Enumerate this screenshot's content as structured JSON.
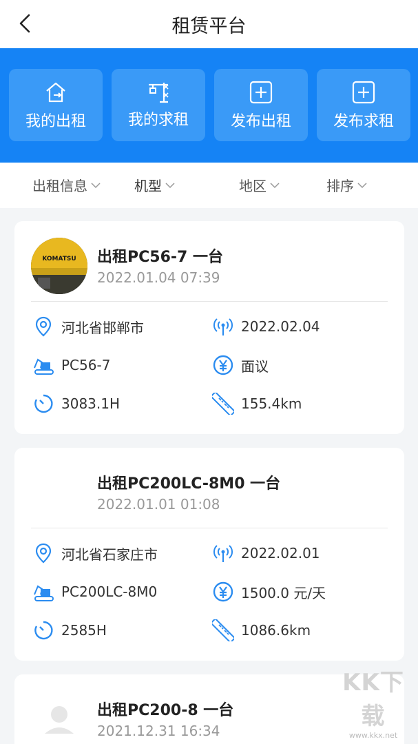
{
  "header": {
    "title": "租赁平台"
  },
  "actions": [
    {
      "label": "我的出租",
      "icon": "house-export-icon"
    },
    {
      "label": "我的求租",
      "icon": "crane-icon"
    },
    {
      "label": "发布出租",
      "icon": "plus-box-icon"
    },
    {
      "label": "发布求租",
      "icon": "plus-box-icon"
    }
  ],
  "filters": [
    {
      "label": "出租信息"
    },
    {
      "label": "机型"
    },
    {
      "label": "地区"
    },
    {
      "label": "排序"
    }
  ],
  "listings": [
    {
      "title": "出租PC56-7 一台",
      "time": "2022.01.04 07:39",
      "location": "河北省邯郸市",
      "date": "2022.02.04",
      "model": "PC56-7",
      "price": "面议",
      "hours": "3083.1H",
      "distance": "155.4km",
      "avatar_text": "KOMATSU"
    },
    {
      "title": "出租PC200LC-8M0 一台",
      "time": "2022.01.01 01:08",
      "location": "河北省石家庄市",
      "date": "2022.02.01",
      "model": "PC200LC-8M0",
      "price": "1500.0 元/天",
      "hours": "2585H",
      "distance": "1086.6km"
    },
    {
      "title": "出租PC200-8 一台",
      "time": "2021.12.31 16:34"
    }
  ],
  "watermark": {
    "big": "KK下载",
    "small": "www.kkx.net"
  },
  "colors": {
    "primary": "#1583f5",
    "icon": "#2b8cf0"
  }
}
